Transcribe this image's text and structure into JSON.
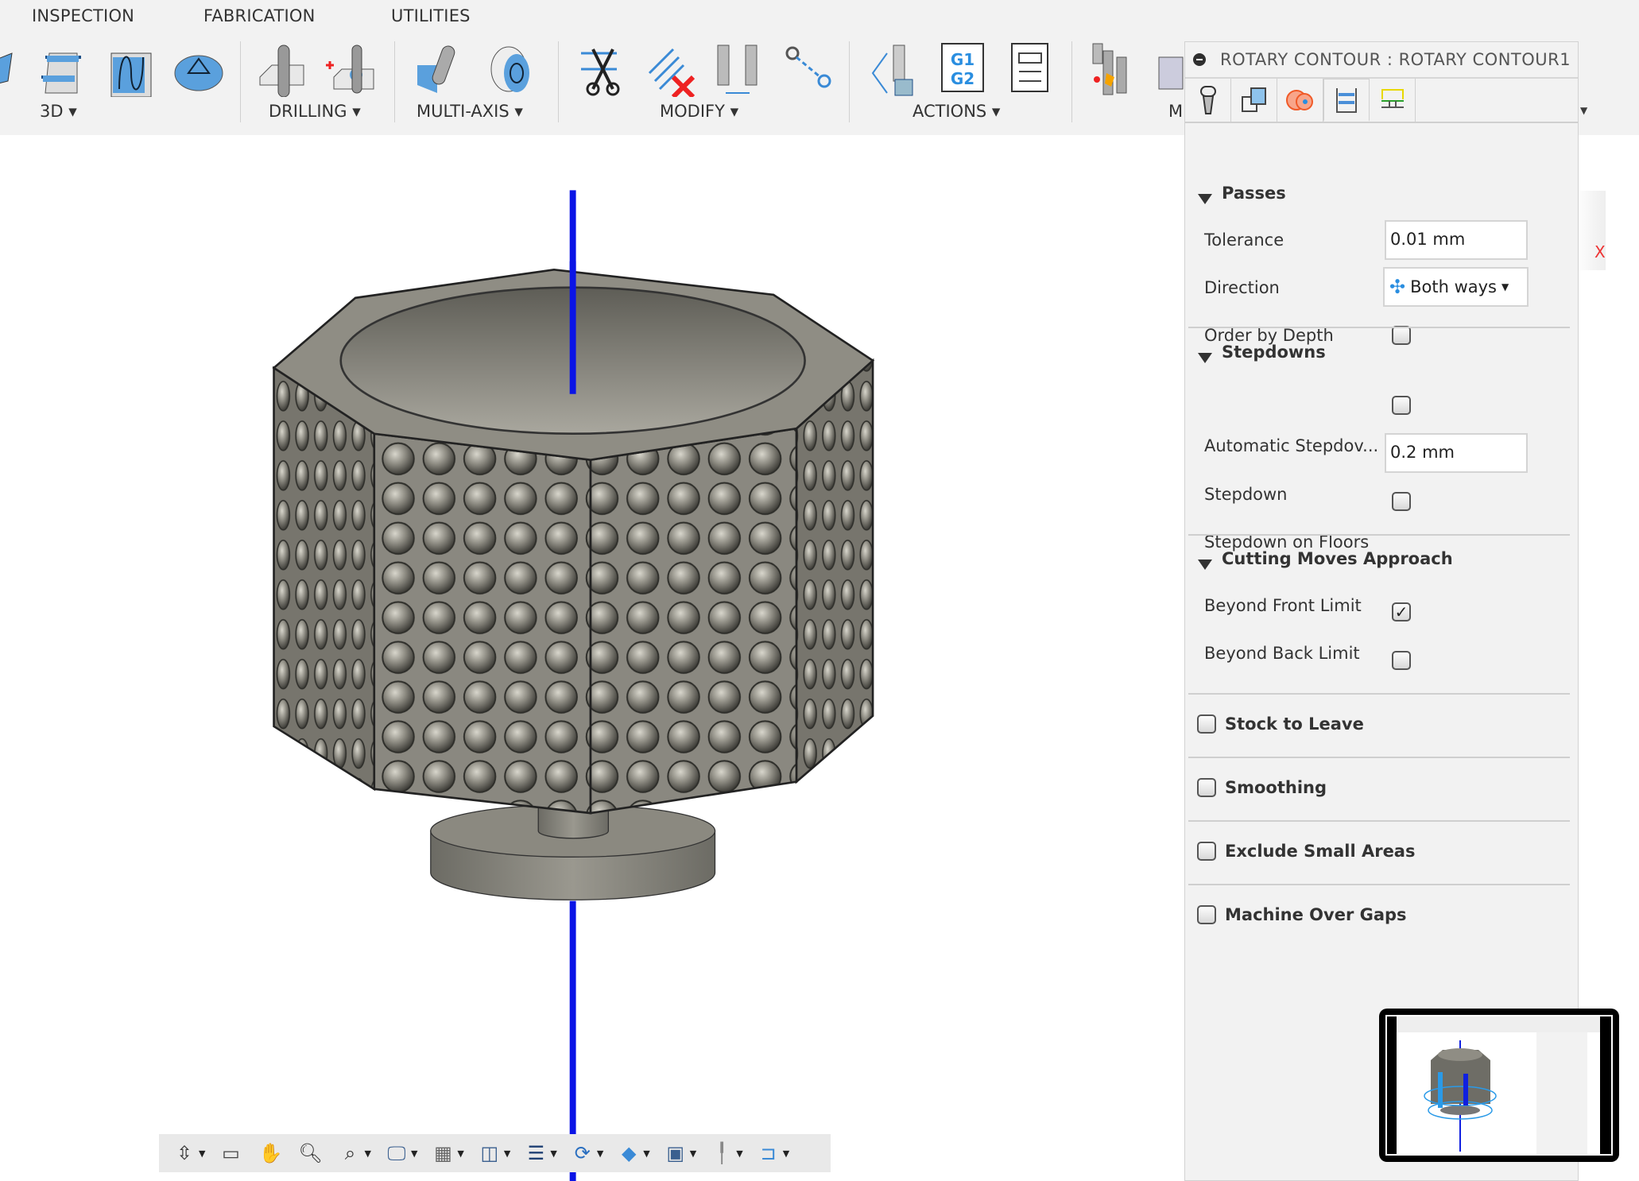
{
  "ribbon": {
    "tabs": [
      "INSPECTION",
      "FABRICATION",
      "UTILITIES"
    ],
    "groups": [
      "3D ▾",
      "DRILLING ▾",
      "MULTI-AXIS ▾",
      "MODIFY ▾",
      "ACTIONS ▾",
      "M"
    ]
  },
  "panel": {
    "title": "ROTARY CONTOUR : ROTARY CONTOUR1",
    "tabs": [
      "tool-tab",
      "geometry-tab",
      "heights-tab",
      "passes-tab",
      "linking-tab"
    ],
    "sections": {
      "passes": {
        "title": "Passes",
        "tolerance_label": "Tolerance",
        "tolerance_value": "0.01 mm",
        "direction_label": "Direction",
        "direction_value": "Both ways",
        "order_label": "Order by Depth",
        "order_checked": false
      },
      "stepdowns": {
        "title": "Stepdowns",
        "auto_label": "Automatic Stepdov...",
        "auto_checked": false,
        "stepdown_label": "Stepdown",
        "stepdown_value": "0.2 mm",
        "floors_label": "Stepdown on Floors",
        "floors_checked": false
      },
      "approach": {
        "title": "Cutting Moves Approach",
        "front_label": "Beyond Front Limit",
        "front_checked": true,
        "back_label": "Beyond Back Limit",
        "back_checked": false
      },
      "stock": {
        "title": "Stock to Leave",
        "checked": false
      },
      "smoothing": {
        "title": "Smoothing",
        "checked": false
      },
      "exclude": {
        "title": "Exclude Small Areas",
        "checked": false
      },
      "gaps": {
        "title": "Machine Over Gaps",
        "checked": false
      }
    }
  },
  "viewcube": {
    "axis_label": "X"
  },
  "colors": {
    "axis": "#0a14e6",
    "model": "#7b7a72",
    "accent": "#2a8ee0"
  }
}
